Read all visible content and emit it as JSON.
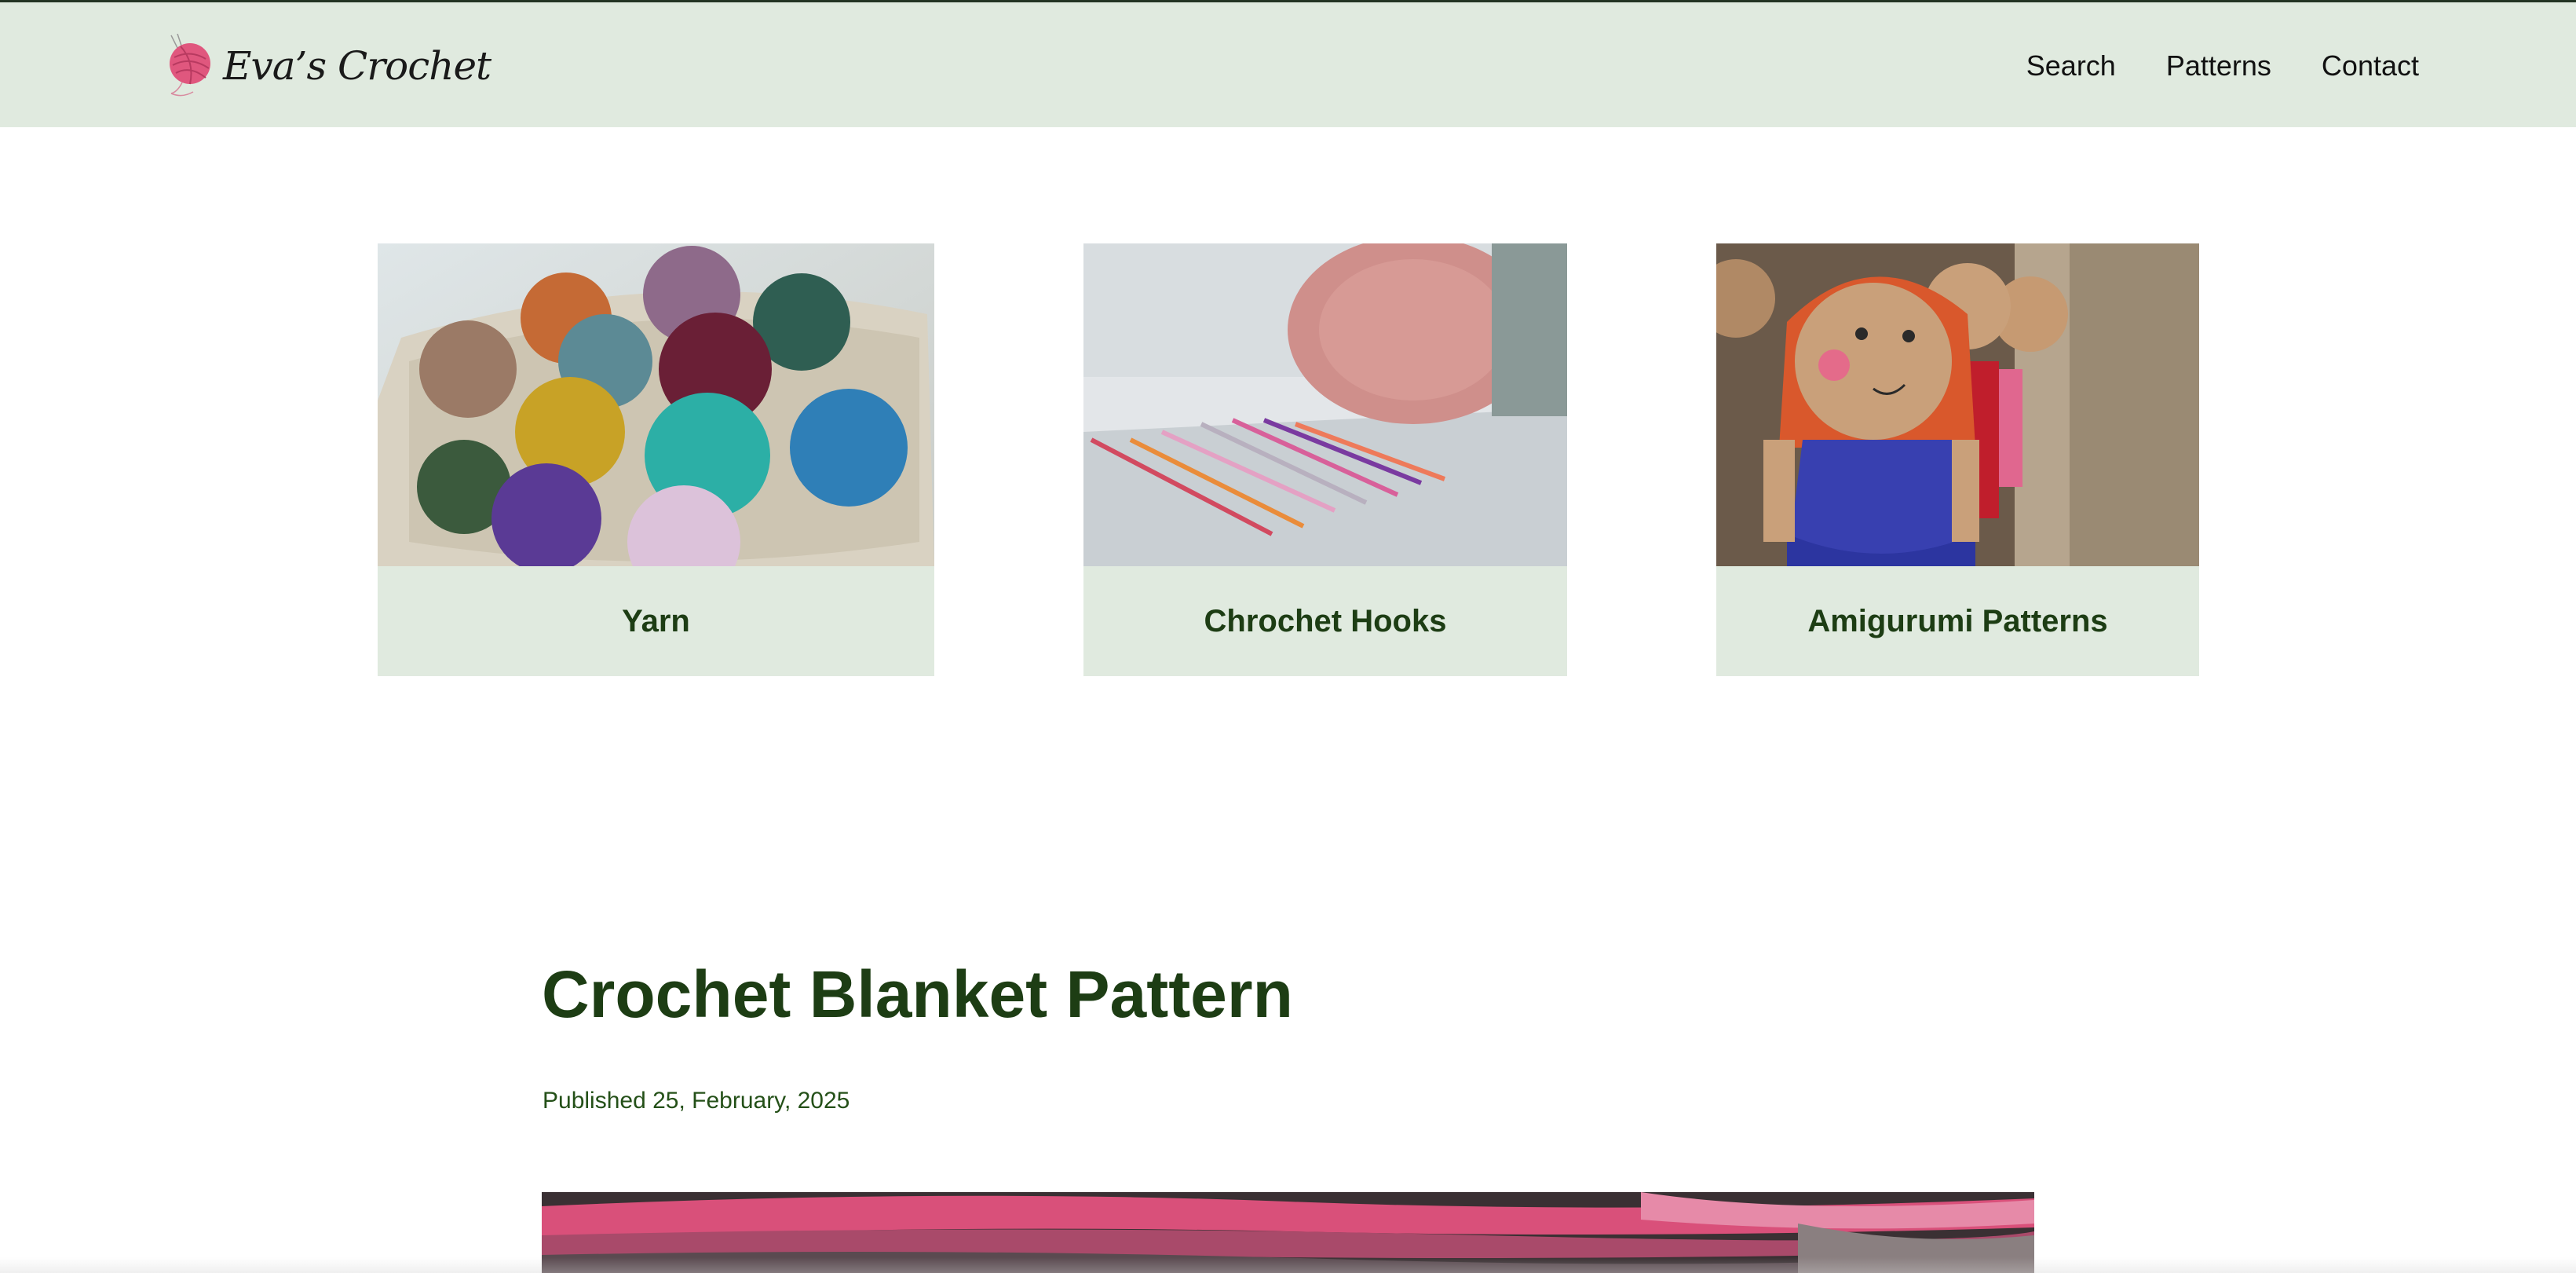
{
  "header": {
    "brand": "Eva’s Crochet",
    "nav": [
      {
        "label": "Search"
      },
      {
        "label": "Patterns"
      },
      {
        "label": "Contact"
      }
    ]
  },
  "categories": [
    {
      "label": "Yarn",
      "image": "yarn-baskets-photo"
    },
    {
      "label": "Chrochet Hooks",
      "image": "crochet-hooks-photo"
    },
    {
      "label": "Amigurumi Patterns",
      "image": "amigurumi-dolls-photo"
    }
  ],
  "article": {
    "title": "Crochet Blanket Pattern",
    "published": "Published 25, February, 2025",
    "hero_image": "crochet-blanket-photo"
  },
  "colors": {
    "header_bg": "#e0eadf",
    "accent_green": "#1d3d14",
    "logo_pink": "#e0577e"
  }
}
